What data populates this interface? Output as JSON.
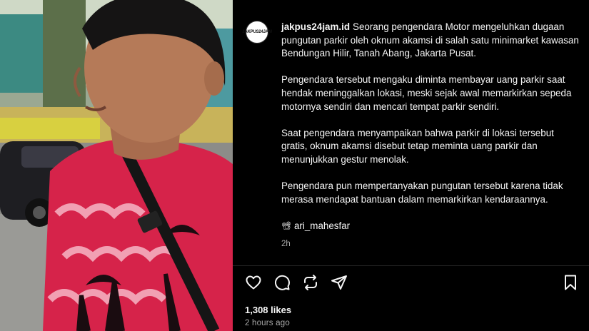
{
  "post": {
    "author": {
      "username": "jakpus24jam.id",
      "avatar_logo": "JAKPUS24JAM"
    },
    "caption": {
      "intro": "Seorang pengendara Motor mengeluhkan dugaan pungutan parkir oleh oknum akamsi di salah satu minimarket kawasan Bendungan Hilir, Tanah Abang, Jakarta Pusat.",
      "paragraphs": [
        "Pengendara tersebut mengaku diminta membayar uang parkir saat hendak meninggalkan lokasi, meski sejak awal memarkirkan sepeda motornya sendiri dan mencari tempat parkir sendiri.",
        "Saat pengendara menyampaikan bahwa parkir di lokasi tersebut gratis, oknum akamsi disebut tetap meminta uang parkir dan menunjukkan gestur menolak.",
        "Pengendara pun mempertanyakan pungutan tersebut karena tidak merasa mendapat bantuan dalam memarkirkan kendaraannya."
      ],
      "credit_icon": "📽",
      "credit": "ari_mahesfar",
      "time_short": "2h"
    },
    "actions": {
      "like_icon": "heart-icon",
      "comment_icon": "comment-icon",
      "repost_icon": "repost-icon",
      "share_icon": "share-icon",
      "save_icon": "bookmark-icon"
    },
    "likes": "1,308 likes",
    "posted": "2 hours ago"
  }
}
